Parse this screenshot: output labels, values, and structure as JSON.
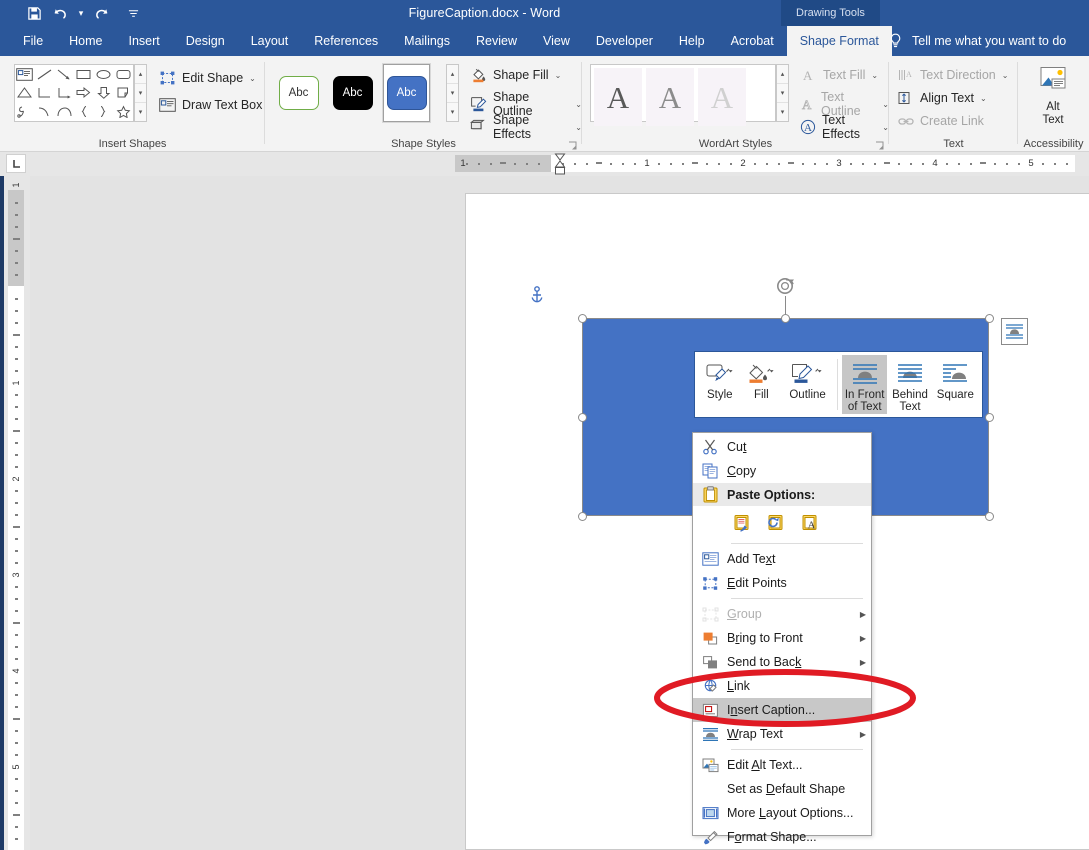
{
  "titlebar": {
    "document_title": "FigureCaption.docx  -  Word",
    "contextual_tab_group": "Drawing Tools",
    "qat": [
      {
        "name": "save-icon",
        "label": "Save"
      },
      {
        "name": "undo-icon",
        "label": "Undo"
      },
      {
        "name": "redo-icon",
        "label": "Redo"
      },
      {
        "name": "customize-qat-icon",
        "label": "Customize Quick Access Toolbar"
      }
    ]
  },
  "ribbon": {
    "tabs": [
      {
        "label": "File",
        "active": false
      },
      {
        "label": "Home",
        "active": false
      },
      {
        "label": "Insert",
        "active": false
      },
      {
        "label": "Design",
        "active": false
      },
      {
        "label": "Layout",
        "active": false
      },
      {
        "label": "References",
        "active": false
      },
      {
        "label": "Mailings",
        "active": false
      },
      {
        "label": "Review",
        "active": false
      },
      {
        "label": "View",
        "active": false
      },
      {
        "label": "Developer",
        "active": false
      },
      {
        "label": "Help",
        "active": false
      },
      {
        "label": "Acrobat",
        "active": false
      },
      {
        "label": "Shape Format",
        "active": true
      }
    ],
    "tell_me": "Tell me what you want to do",
    "groups": [
      {
        "name": "Insert Shapes",
        "label": "Insert Shapes",
        "commands": [
          {
            "label": "Edit Shape",
            "dropdown": true,
            "disabled": false
          },
          {
            "label": "Draw Text Box",
            "dropdown": false,
            "disabled": false
          }
        ]
      },
      {
        "name": "Shape Styles",
        "label": "Shape Styles",
        "gallery": [
          {
            "text": "Abc",
            "style": "outline-green"
          },
          {
            "text": "Abc",
            "style": "filled-black"
          },
          {
            "text": "Abc",
            "style": "filled-blue-selected"
          }
        ],
        "commands": [
          {
            "label": "Shape Fill",
            "dropdown": true,
            "disabled": false
          },
          {
            "label": "Shape Outline",
            "dropdown": true,
            "disabled": false
          },
          {
            "label": "Shape Effects",
            "dropdown": true,
            "disabled": false
          }
        ]
      },
      {
        "name": "WordArt Styles",
        "label": "WordArt Styles",
        "gallery": [
          "A",
          "A",
          "A"
        ],
        "commands": [
          {
            "label": "Text Fill",
            "dropdown": true,
            "disabled": true
          },
          {
            "label": "Text Outline",
            "dropdown": true,
            "disabled": true
          },
          {
            "label": "Text Effects",
            "dropdown": true,
            "disabled": false
          }
        ]
      },
      {
        "name": "Text",
        "label": "Text",
        "commands": [
          {
            "label": "Text Direction",
            "dropdown": true,
            "disabled": true
          },
          {
            "label": "Align Text",
            "dropdown": true,
            "disabled": false
          },
          {
            "label": "Create Link",
            "dropdown": false,
            "disabled": true
          }
        ]
      },
      {
        "name": "Accessibility",
        "label": "Accessibility",
        "commands": [
          {
            "label": "Alt Text",
            "line1": "Alt",
            "line2": "Text",
            "disabled": false
          }
        ]
      }
    ]
  },
  "ruler": {
    "horizontal_numbers": [
      "1",
      "1",
      "2",
      "3",
      "4",
      "5"
    ],
    "vertical_numbers": [
      "1",
      "1",
      "2",
      "3",
      "4",
      "5"
    ],
    "tab_stop_indicator": "L"
  },
  "mini_toolbar": {
    "items": [
      {
        "label": "Style",
        "dropdown": true,
        "selected": false,
        "icon": "shape-style-icon"
      },
      {
        "label": "Fill",
        "dropdown": true,
        "selected": false,
        "icon": "fill-bucket-icon"
      },
      {
        "label": "Outline",
        "dropdown": true,
        "selected": false,
        "icon": "outline-pen-icon"
      }
    ],
    "wrap_items": [
      {
        "line1": "In Front",
        "line2": "of Text",
        "selected": true,
        "icon": "wrap-in-front-of-text-icon"
      },
      {
        "line1": "Behind",
        "line2": "Text",
        "selected": false,
        "icon": "wrap-behind-text-icon"
      },
      {
        "line1": "Square",
        "line2": "",
        "selected": false,
        "icon": "wrap-square-icon"
      }
    ]
  },
  "context_menu": {
    "items": [
      {
        "type": "item",
        "label": "Cut",
        "accel": "t",
        "icon": "scissors-icon",
        "submenu": false,
        "disabled": false,
        "highlighted": false
      },
      {
        "type": "item",
        "label": "Copy",
        "accel": "C",
        "icon": "copy-icon",
        "submenu": false,
        "disabled": false,
        "highlighted": false
      },
      {
        "type": "header",
        "label": "Paste Options:",
        "icon": "paste-icon"
      },
      {
        "type": "paste-row",
        "options": [
          {
            "name": "paste-keep-source-formatting-icon",
            "label": "Keep Source Formatting"
          },
          {
            "name": "paste-picture-icon",
            "label": "Picture"
          },
          {
            "name": "paste-keep-text-only-icon",
            "label": "Keep Text Only"
          }
        ]
      },
      {
        "type": "separator"
      },
      {
        "type": "item",
        "label": "Add Text",
        "accel": "x",
        "icon": "add-text-icon",
        "submenu": false,
        "disabled": false,
        "highlighted": false
      },
      {
        "type": "item",
        "label": "Edit Points",
        "accel": "E",
        "icon": "edit-points-icon",
        "submenu": false,
        "disabled": false,
        "highlighted": false
      },
      {
        "type": "separator"
      },
      {
        "type": "item",
        "label": "Group",
        "accel": "G",
        "icon": "group-icon",
        "submenu": true,
        "disabled": true,
        "highlighted": false
      },
      {
        "type": "item",
        "label": "Bring to Front",
        "accel": "r",
        "icon": "bring-to-front-icon",
        "submenu": true,
        "disabled": false,
        "highlighted": false
      },
      {
        "type": "item",
        "label": "Send to Back",
        "accel": "k",
        "icon": "send-to-back-icon",
        "submenu": true,
        "disabled": false,
        "highlighted": false
      },
      {
        "type": "item",
        "label": "Link",
        "accel": "L",
        "icon": "link-icon",
        "submenu": false,
        "disabled": false,
        "highlighted": false
      },
      {
        "type": "item",
        "label": "Insert Caption...",
        "accel": "n",
        "icon": "insert-caption-icon",
        "submenu": false,
        "disabled": false,
        "highlighted": true
      },
      {
        "type": "item",
        "label": "Wrap Text",
        "accel": "W",
        "icon": "wrap-text-icon",
        "submenu": true,
        "disabled": false,
        "highlighted": false
      },
      {
        "type": "separator"
      },
      {
        "type": "item",
        "label": "Edit Alt Text...",
        "accel": "A",
        "icon": "edit-alt-text-icon",
        "submenu": false,
        "disabled": false,
        "highlighted": false
      },
      {
        "type": "item",
        "label": "Set as Default Shape",
        "accel": "D",
        "icon": "none",
        "submenu": false,
        "disabled": false,
        "highlighted": false
      },
      {
        "type": "item",
        "label": "More Layout Options...",
        "accel": "L",
        "icon": "more-layout-options-icon",
        "submenu": false,
        "disabled": false,
        "highlighted": false
      },
      {
        "type": "item",
        "label": "Format Shape...",
        "accel": "o",
        "icon": "format-shape-icon",
        "submenu": false,
        "disabled": false,
        "highlighted": false
      }
    ]
  },
  "canvas": {
    "shape": {
      "name": "blue-rectangle",
      "fill": "#4472c4",
      "selected": true
    },
    "anchor_icon": "object-anchor-icon",
    "layout_options_button": "layout-options-button",
    "rotate_handle": "rotate-handle"
  },
  "annotation": {
    "ellipse_color": "#e01b24",
    "target": "Insert Caption..."
  },
  "colors": {
    "word_blue": "#2b579a",
    "contextual_tab": "#204a86",
    "ribbon_bg": "#f3f3f3",
    "canvas_bg": "#e3e3e3",
    "shape_fill": "#4472c4",
    "highlight": "#c8c8c8",
    "annotation_red": "#e01b24"
  }
}
